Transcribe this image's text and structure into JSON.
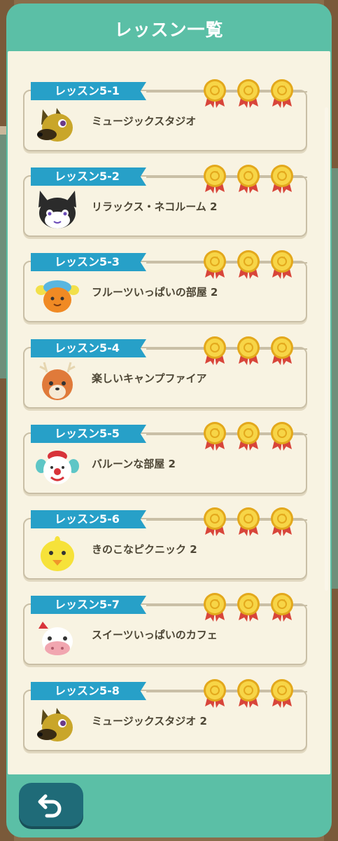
{
  "title": "レッスン一覧",
  "lessons": [
    {
      "label": "レッスン5-1",
      "name": "ミュージックスタジオ",
      "medals": 3,
      "avatar": "dog-villager-avatar"
    },
    {
      "label": "レッスン5-2",
      "name": "リラックス・ネコルーム 2",
      "medals": 3,
      "avatar": "cat-villager-avatar"
    },
    {
      "label": "レッスン5-3",
      "name": "フルーツいっぱいの部屋 2",
      "medals": 3,
      "avatar": "orange-cap-villager-avatar"
    },
    {
      "label": "レッスン5-4",
      "name": "楽しいキャンプファイア",
      "medals": 3,
      "avatar": "deer-villager-avatar"
    },
    {
      "label": "レッスン5-5",
      "name": "バルーンな部屋 2",
      "medals": 3,
      "avatar": "clown-villager-avatar"
    },
    {
      "label": "レッスン5-6",
      "name": "きのこなピクニック 2",
      "medals": 3,
      "avatar": "chick-villager-avatar"
    },
    {
      "label": "レッスン5-7",
      "name": "スイーツいっぱいのカフェ",
      "medals": 3,
      "avatar": "cow-villager-avatar"
    },
    {
      "label": "レッスン5-8",
      "name": "ミュージックスタジオ 2",
      "medals": 3,
      "avatar": "dog-villager-avatar"
    }
  ],
  "colors": {
    "panel": "#5bbfa6",
    "label": "#27a0c8",
    "medal": "#f2c62e",
    "ribbon": "#d8453a",
    "back": "#1f6b78"
  },
  "back_icon": "undo-arrow-icon"
}
